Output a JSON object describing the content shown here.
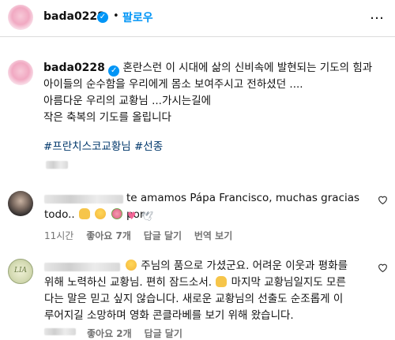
{
  "header": {
    "username": "bada0228",
    "separator": "•",
    "follow_label": "팔로우",
    "more_label": "…"
  },
  "caption": {
    "username": "bada0228",
    "lines": [
      "혼란스런 이 시대에 삶의 신비속에 발현되는 기도의 힘과",
      "아이들의 순수함을 우리에게 몸소 보여주시고 전하셨던 ....",
      "아름다운 우리의 교황님 ...가시는길에",
      "작은 축복의 기도를 올립니다"
    ],
    "hashtags": "#프란치스코교황님 #선종"
  },
  "comments": [
    {
      "text_line1": "te amamos Pápa Francisco, muchas gracias por",
      "text_line2": "todo..",
      "time": "11시간",
      "likes": "좋아요 7개",
      "reply": "답글 달기",
      "translate": "번역 보기"
    },
    {
      "text_line1": "주님의 품으로 가셨군요. 어려운 이웃과 평화를",
      "text_line2": "위해 노력하신 교황님. 편히 잠드소서.",
      "text_line2b": "마지막 교황님일지도 모른",
      "text_line3": "다는 말은 믿고 싶지 않습니다. 새로운 교황님의 선출도 순조롭게 이",
      "text_line4": "루어지길 소망하며 영화 콘클라베를 보기 위해 왔습니다.",
      "likes": "좋아요 2개",
      "reply": "답글 달기"
    }
  ],
  "colors": {
    "accent": "#0095f6",
    "hashtag": "#00376b",
    "meta": "#737373"
  }
}
